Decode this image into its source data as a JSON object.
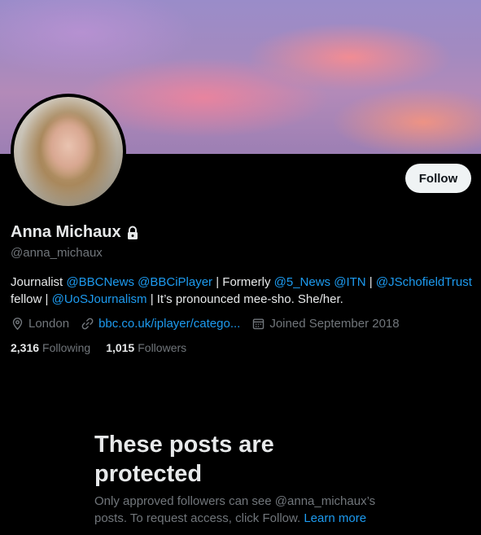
{
  "profile": {
    "display_name": "Anna Michaux",
    "handle": "@anna_michaux",
    "follow_label": "Follow",
    "bio": {
      "t1": "Journalist ",
      "m1": "@BBCNews",
      "t2": " ",
      "m2": "@BBCiPlayer",
      "t3": " | Formerly ",
      "m3": "@5_News",
      "t4": " ",
      "m4": "@ITN",
      "t5": " | ",
      "m5": "@JSchofieldTrust",
      "t6": " fellow | ",
      "m6": "@UoSJournalism",
      "t7": " | It’s pronounced mee-sho. She/her."
    },
    "location": "London",
    "website": "bbc.co.uk/iplayer/catego...",
    "joined": "Joined September 2018",
    "following_count": "2,316",
    "following_label": "Following",
    "followers_count": "1,015",
    "followers_label": "Followers"
  },
  "protected": {
    "title": "These posts are protected",
    "desc": "Only approved followers can see @anna_michaux’s posts. To request access, click Follow. ",
    "learn_more": "Learn more"
  },
  "colors": {
    "background": "#000000",
    "text": "#e7e9ea",
    "secondary": "#71767b",
    "link": "#1d9bf0",
    "button_bg": "#eff3f4"
  },
  "icons": [
    "lock-icon",
    "location-icon",
    "link-icon",
    "calendar-icon"
  ]
}
